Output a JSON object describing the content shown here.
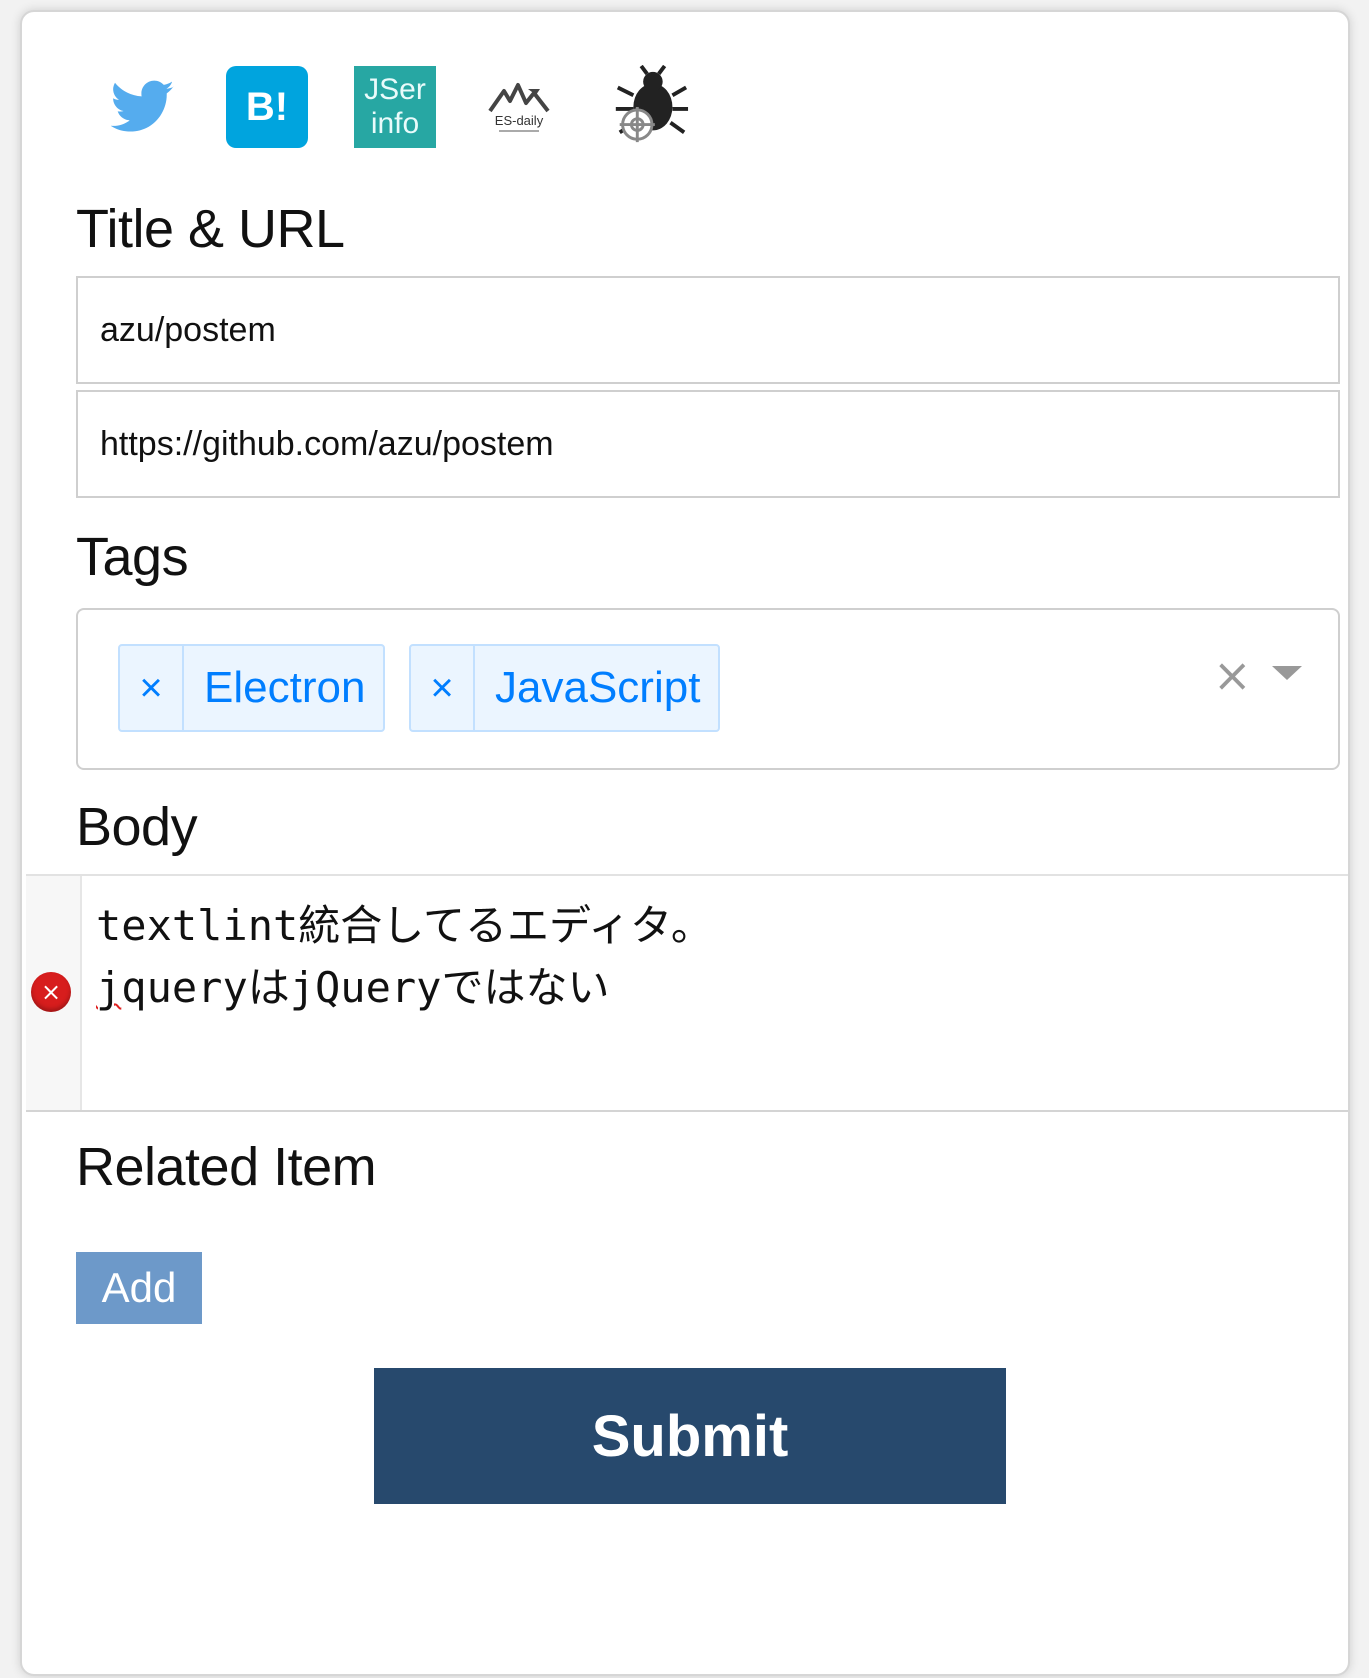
{
  "services": {
    "twitter": {
      "icon": "twitter-bird-icon",
      "color": "#55acee"
    },
    "hatena": {
      "label": "B!",
      "color": "#00a4de"
    },
    "jser": {
      "line1": "JSer",
      "line2": "info",
      "color": "#27a7a3"
    },
    "esdaily": {
      "label": "ES-daily"
    },
    "debug": {
      "icon": "bug-icon"
    }
  },
  "title_url": {
    "heading": "Title & URL",
    "title_value": "azu/postem",
    "url_value": "https://github.com/azu/postem"
  },
  "tags": {
    "heading": "Tags",
    "items": [
      {
        "label": "Electron",
        "remove": "×"
      },
      {
        "label": "JavaScript",
        "remove": "×"
      }
    ],
    "clear": "×"
  },
  "body": {
    "heading": "Body",
    "line1": "textlint統合してるエディタ。",
    "line2_err": "j",
    "line2_rest": "queryはjQueryではない",
    "error_marker": "×"
  },
  "related": {
    "heading": "Related Item",
    "add_label": "Add"
  },
  "submit_label": "Submit",
  "colors": {
    "tag_text": "#007eff",
    "add_button": "#6d99c9",
    "submit_button": "#27496d",
    "error": "#d71d1d"
  }
}
